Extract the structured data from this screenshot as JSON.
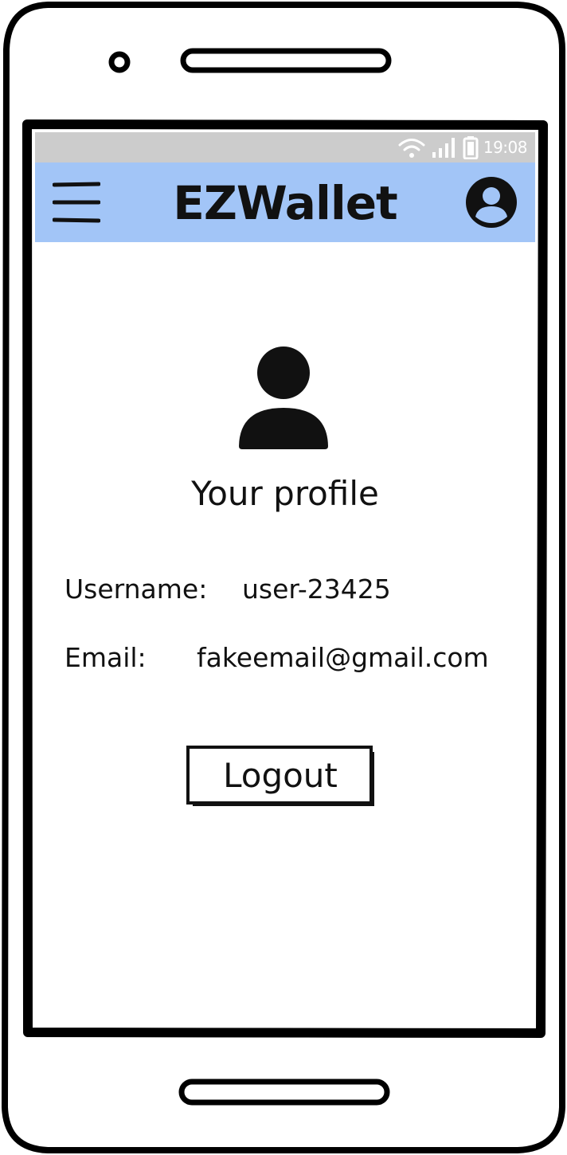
{
  "status_bar": {
    "time": "19:08",
    "icons": [
      "wifi-icon",
      "signal-icon",
      "battery-icon"
    ]
  },
  "app_bar": {
    "menu_icon": "hamburger-menu-icon",
    "title": "EZWallet",
    "account_icon": "account-circle-icon"
  },
  "profile": {
    "avatar_icon": "user-avatar-icon",
    "heading": "Your profile",
    "username_label": "Username:",
    "username_value": "user-23425",
    "email_label": "Email:",
    "email_value": "fakeemail@gmail.com"
  },
  "actions": {
    "logout_label": "Logout"
  },
  "colors": {
    "app_bar": "#a2c5f7",
    "status_bar": "#cccccc",
    "ink": "#111111"
  }
}
